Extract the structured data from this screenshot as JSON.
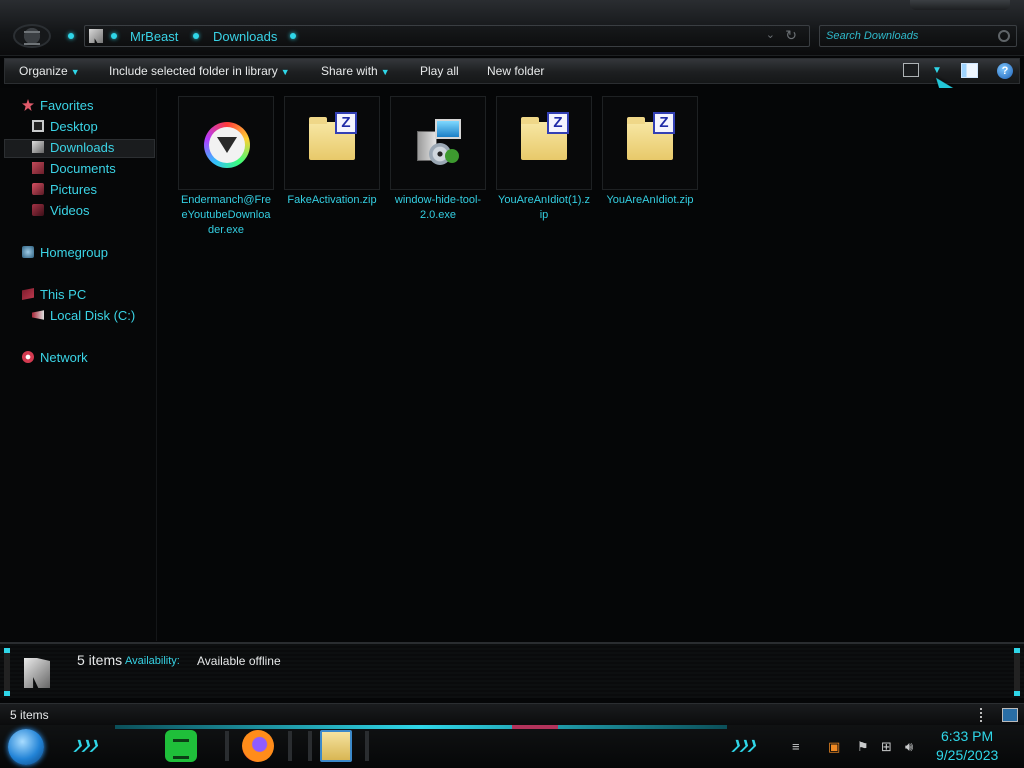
{
  "address": {
    "crumbs": [
      "MrBeast",
      "Downloads"
    ]
  },
  "search": {
    "placeholder": "Search Downloads"
  },
  "toolbar": {
    "organize": "Organize",
    "include": "Include selected folder in library",
    "share": "Share with",
    "play_all": "Play all",
    "new_folder": "New folder"
  },
  "nav": {
    "favorites": "Favorites",
    "desktop": "Desktop",
    "downloads": "Downloads",
    "documents": "Documents",
    "pictures": "Pictures",
    "videos": "Videos",
    "homegroup": "Homegroup",
    "this_pc": "This PC",
    "local_disk": "Local Disk (C:)",
    "network": "Network"
  },
  "files": [
    {
      "name": "Endermanch@FreeYoutubeDownloader.exe",
      "icon": "ender-app-icon"
    },
    {
      "name": "FakeActivation.zip",
      "icon": "zip-folder-icon"
    },
    {
      "name": "window-hide-tool-2.0.exe",
      "icon": "installer-icon"
    },
    {
      "name": "YouAreAnIdiot(1).zip",
      "icon": "zip-folder-icon"
    },
    {
      "name": "YouAreAnIdiot.zip",
      "icon": "zip-folder-icon"
    }
  ],
  "details": {
    "count": "5 items",
    "availability_label": "Availability:",
    "availability_value": "Available offline"
  },
  "status": {
    "count": "5 items"
  },
  "clock": {
    "time": "6:33 PM",
    "date": "9/25/2023"
  },
  "colors": {
    "accent": "#2fd6e8",
    "background": "#050607"
  }
}
